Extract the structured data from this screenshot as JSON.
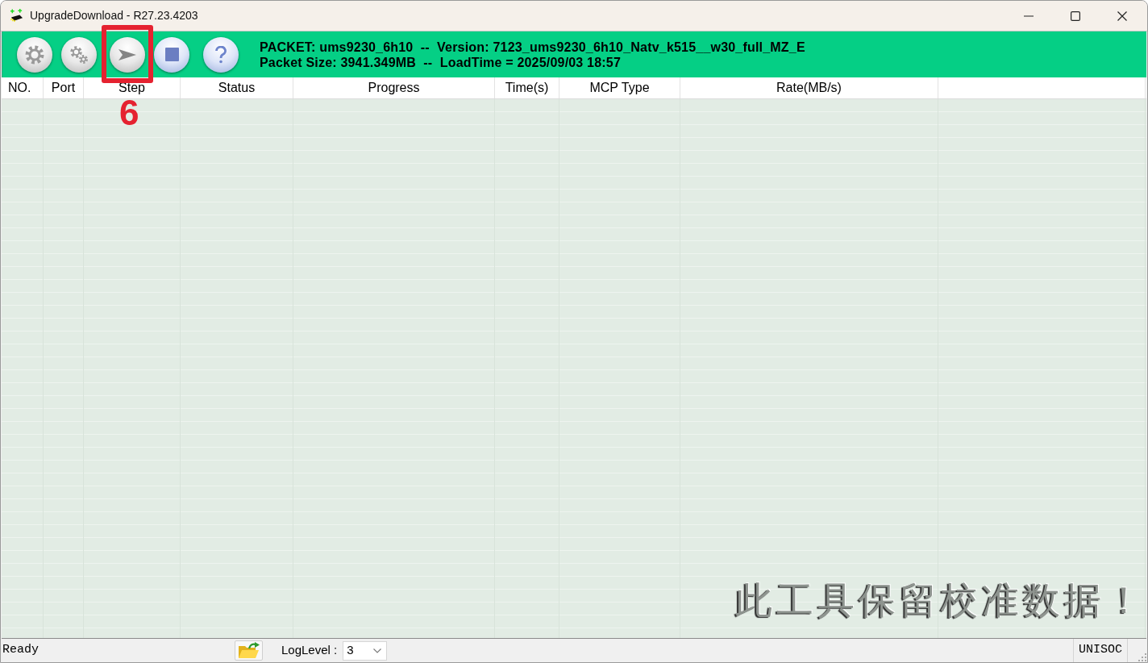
{
  "window": {
    "title": "UpgradeDownload - R27.23.4203"
  },
  "toolbar": {
    "buttons": [
      {
        "kind": "settings",
        "marked": false
      },
      {
        "kind": "options",
        "marked": false
      },
      {
        "kind": "start",
        "marked": true
      },
      {
        "kind": "stop",
        "marked": false
      },
      {
        "kind": "help",
        "marked": false
      }
    ],
    "packet_info": [
      "PACKET: ums9230_6h10  --  Version: 7123_ums9230_6h10_Natv_k515__w30_full_MZ_E",
      "Packet Size: 3941.349MB  --  LoadTime = 2025/09/03 18:57"
    ]
  },
  "table": {
    "columns": [
      "NO.",
      "Port",
      "Step",
      "Status",
      "Progress",
      "Time(s)",
      "MCP Type",
      "Rate(MB/s)"
    ],
    "notice": "此工具保留校准数据！"
  },
  "status_bar": {
    "status": "Ready",
    "log_level_label": "LogLevel :",
    "log_level": "3",
    "vendor": "UNISOC"
  },
  "annotation": {
    "label": "6"
  }
}
